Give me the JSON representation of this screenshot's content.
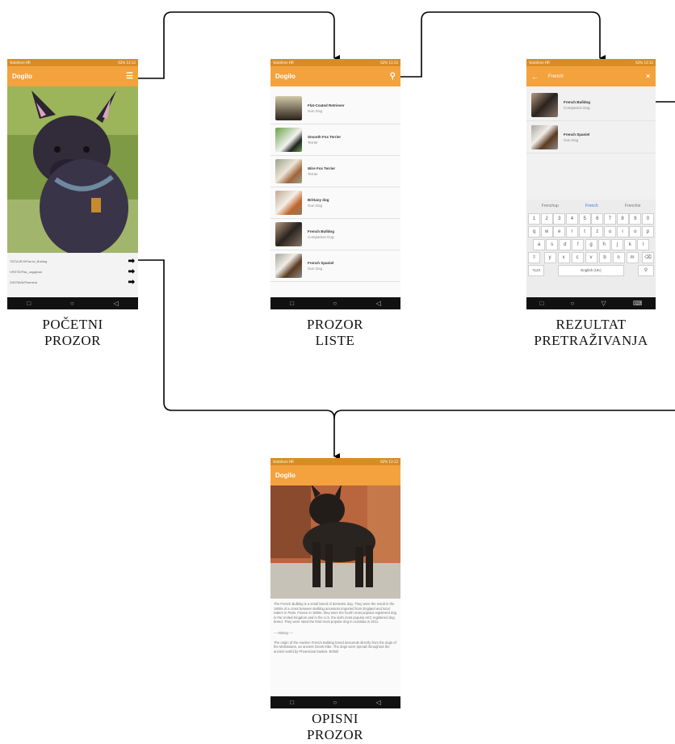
{
  "status": {
    "left": "Vodafone HR",
    "right": "62% 13:12"
  },
  "screens": {
    "pocetni": {
      "caption_line1": "POČETNI",
      "caption_line2": "PROZOR",
      "app_title": "Dogilo",
      "menu_items": [
        "TEČAJEVI/Parovi_Buldog",
        "VRSTE/Pas_uzgajivač",
        "ZASTAVA/Pasmina"
      ]
    },
    "lista": {
      "caption_line1": "PROZOR",
      "caption_line2": "LISTE",
      "app_title": "Dogilo",
      "items": [
        {
          "title": "Flat-Coated Retriever",
          "sub": "Gun Dog"
        },
        {
          "title": "Smooth Fox Terrier",
          "sub": "Terrier"
        },
        {
          "title": "Wire Fox Terrier",
          "sub": "Terrier"
        },
        {
          "title": "Brittany dog",
          "sub": "Gun Dog"
        },
        {
          "title": "French Bulldog",
          "sub": "Companion Dog"
        },
        {
          "title": "French Spaniel",
          "sub": "Gun Dog"
        }
      ]
    },
    "rezultat": {
      "caption_line1": "REZULTAT",
      "caption_line2": "PRETRAŽIVANJA",
      "search_query": "French",
      "results": [
        {
          "title": "French Bulldog",
          "sub": "Companion Dog"
        },
        {
          "title": "French Spaniel",
          "sub": "Gun Dog"
        }
      ],
      "suggestions": [
        "Frenchup",
        "French",
        "Frenchie"
      ],
      "num_row": [
        "1",
        "2",
        "3",
        "4",
        "5",
        "6",
        "7",
        "8",
        "9",
        "0"
      ],
      "row1": [
        "q",
        "w",
        "e",
        "r",
        "t",
        "z",
        "u",
        "i",
        "o",
        "p"
      ],
      "row2": [
        "a",
        "s",
        "d",
        "f",
        "g",
        "h",
        "j",
        "k",
        "l"
      ],
      "row3": [
        "y",
        "x",
        "c",
        "v",
        "b",
        "n",
        "m"
      ],
      "lang_key": "English (UK)",
      "num_key": "?123"
    },
    "opisni": {
      "caption_line1": "OPISNI",
      "caption_line2": "PROZOR",
      "app_title": "Dogilo",
      "description": "The French Bulldog is a small breed of domestic dog. They were the result in the 1800s of a cross between Bulldog ancestors imported from England and local ratters in Paris, France in 1800s. they were the fourth most popular registered dog in the United Kingdom and in the U.S. the sixth most popular AKC registered dog breed. They were rated the third most popular dog in Australia in 2011.",
      "history_heading": "--- History ---",
      "history": "The origin of the modern French Bulldog breed descends directly from the dogs of the Molossians, an ancient Greek tribe. The dogs were spread throughout the ancient world by Phoenician traders. British"
    }
  },
  "colors": {
    "appbar": "#f4a23d",
    "status": "#d98c26",
    "navbar": "#111111"
  }
}
